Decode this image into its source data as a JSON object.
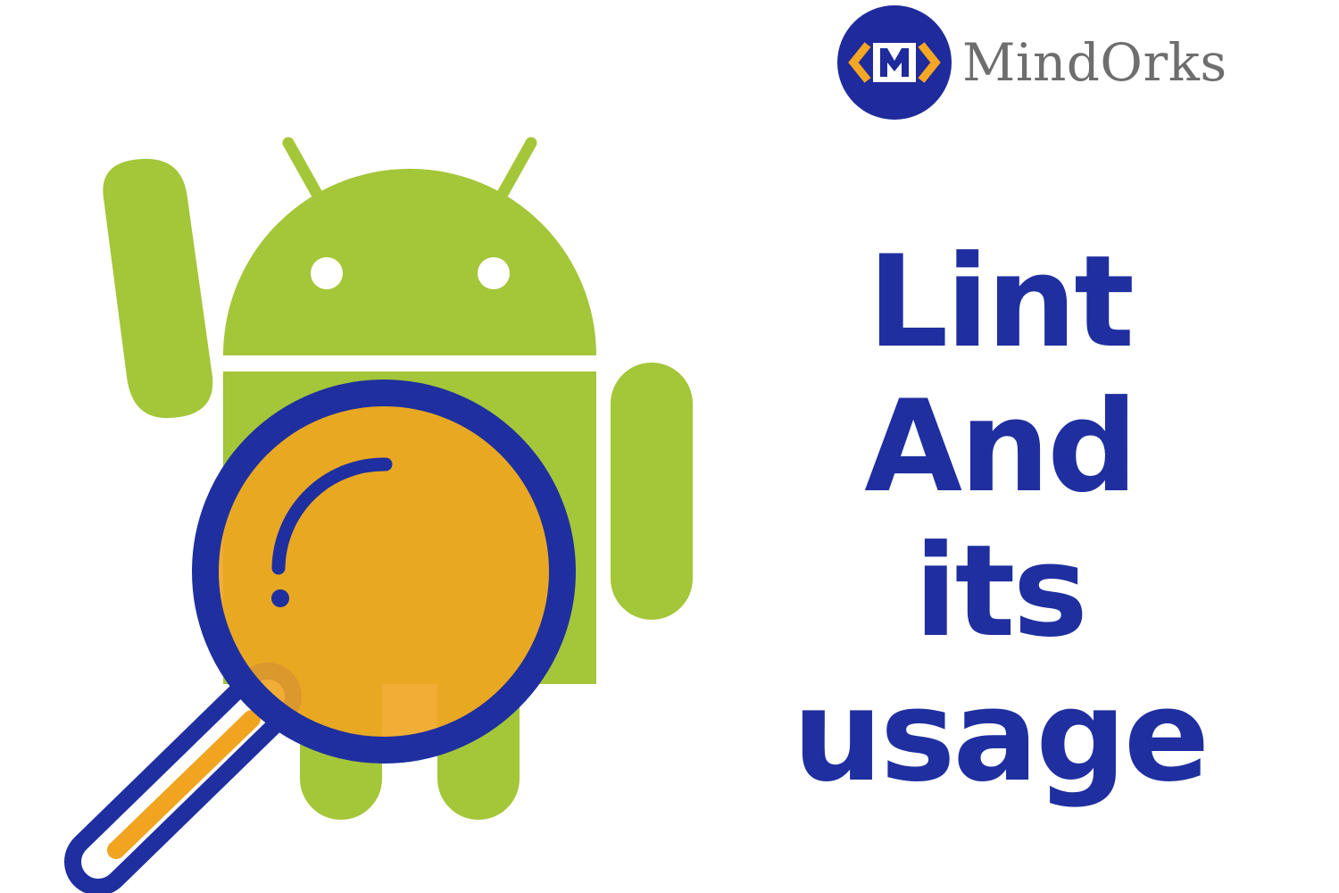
{
  "brand": {
    "name": "MindOrks",
    "logo_text": "<M>",
    "logo_color": "#1f2a9c",
    "logo_accent": "#f5a623"
  },
  "headline": {
    "line1": "Lint",
    "line2": "And its",
    "line3": "usage",
    "color": "#1f2fa0"
  },
  "illustration": {
    "robot_icon": "android-robot-icon",
    "magnifier_icon": "magnifying-glass-icon",
    "robot_color": "#a4c639",
    "lens_color": "#f0a420",
    "rim_color": "#1f2fa0"
  }
}
